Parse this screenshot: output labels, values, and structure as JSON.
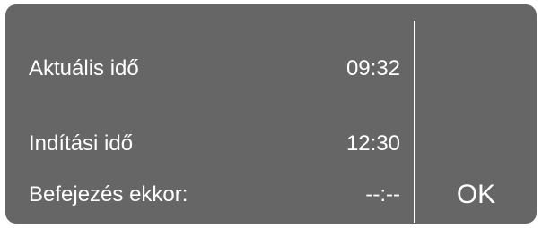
{
  "display": {
    "rows": [
      {
        "label": "Aktuális idő",
        "value": "09:32"
      },
      {
        "label": "Indítási idő",
        "value": "12:30"
      },
      {
        "label": "Befejezés ekkor:",
        "value": "--:--"
      }
    ],
    "ok_label": "OK"
  },
  "colors": {
    "screen_background": "#666666",
    "text": "#ffffff"
  }
}
